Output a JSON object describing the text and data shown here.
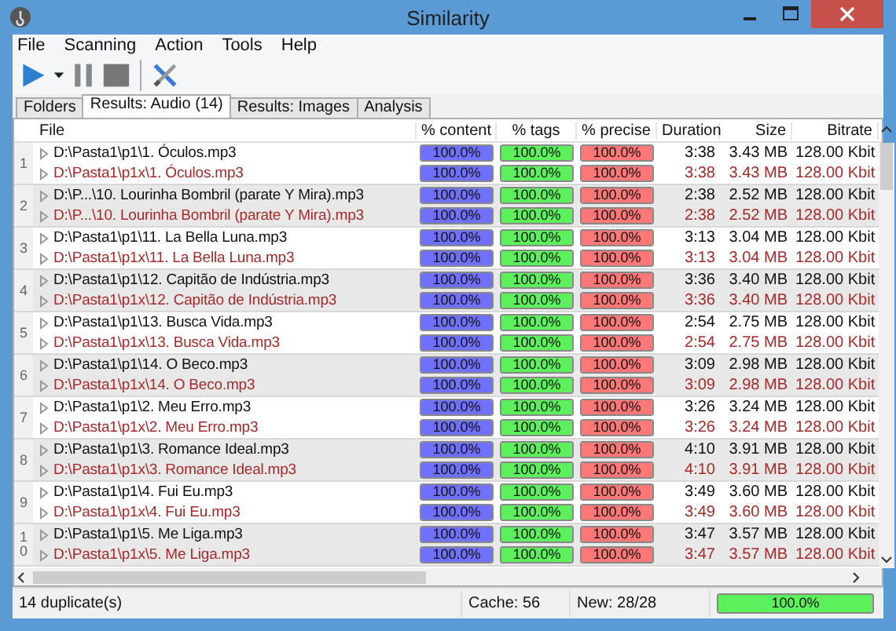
{
  "window": {
    "title": "Similarity"
  },
  "menu": [
    "File",
    "Scanning",
    "Action",
    "Tools",
    "Help"
  ],
  "tabs": [
    {
      "label": "Folders",
      "selected": false
    },
    {
      "label": "Results: Audio (14)",
      "selected": true
    },
    {
      "label": "Results: Images",
      "selected": false
    },
    {
      "label": "Analysis",
      "selected": false
    }
  ],
  "table": {
    "columns": [
      "File",
      "% content",
      "% tags",
      "% precise",
      "Duration",
      "Size",
      "Bitrate"
    ],
    "groups": [
      {
        "number": "1",
        "rows": [
          {
            "duplicate": false,
            "file": "D:\\Pasta1\\p1\\1. Óculos.mp3",
            "bars": [
              {
                "text": "100.0%",
                "level": 1
              },
              {
                "text": "100.0%",
                "level": 1
              },
              {
                "text": "100.0%",
                "level": 1
              }
            ],
            "duration": "3:38",
            "size": "3.43 MB",
            "bitrate": "128.00 Kbit"
          },
          {
            "duplicate": true,
            "file": "D:\\Pasta1\\p1x\\1. Óculos.mp3",
            "bars": [
              {
                "text": "100.0%",
                "level": 1
              },
              {
                "text": "100.0%",
                "level": 1
              },
              {
                "text": "100.0%",
                "level": 1
              }
            ],
            "duration": "3:38",
            "size": "3.43 MB",
            "bitrate": "128.00 Kbit"
          }
        ]
      },
      {
        "number": "2",
        "rows": [
          {
            "duplicate": false,
            "file": "D:\\P...\\10. Lourinha Bombril (parate Y Mira).mp3",
            "bars": [
              {
                "text": "100.0%",
                "level": 1
              },
              {
                "text": "100.0%",
                "level": 1
              },
              {
                "text": "100.0%",
                "level": 1
              }
            ],
            "duration": "2:38",
            "size": "2.52 MB",
            "bitrate": "128.00 Kbit"
          },
          {
            "duplicate": true,
            "file": "D:\\P...\\10. Lourinha Bombril (parate Y Mira).mp3",
            "bars": [
              {
                "text": "100.0%",
                "level": 1
              },
              {
                "text": "100.0%",
                "level": 1
              },
              {
                "text": "100.0%",
                "level": 1
              }
            ],
            "duration": "2:38",
            "size": "2.52 MB",
            "bitrate": "128.00 Kbit"
          }
        ]
      },
      {
        "number": "3",
        "rows": [
          {
            "duplicate": false,
            "file": "D:\\Pasta1\\p1\\11. La Bella Luna.mp3",
            "bars": [
              {
                "text": "100.0%",
                "level": 1
              },
              {
                "text": "100.0%",
                "level": 1
              },
              {
                "text": "100.0%",
                "level": 1
              }
            ],
            "duration": "3:13",
            "size": "3.04 MB",
            "bitrate": "128.00 Kbit"
          },
          {
            "duplicate": true,
            "file": "D:\\Pasta1\\p1x\\11. La Bella Luna.mp3",
            "bars": [
              {
                "text": "100.0%",
                "level": 1
              },
              {
                "text": "100.0%",
                "level": 1
              },
              {
                "text": "100.0%",
                "level": 1
              }
            ],
            "duration": "3:13",
            "size": "3.04 MB",
            "bitrate": "128.00 Kbit"
          }
        ]
      },
      {
        "number": "4",
        "rows": [
          {
            "duplicate": false,
            "file": "D:\\Pasta1\\p1\\12. Capitão de Indústria.mp3",
            "bars": [
              {
                "text": "100.0%",
                "level": 1
              },
              {
                "text": "100.0%",
                "level": 1
              },
              {
                "text": "100.0%",
                "level": 1
              }
            ],
            "duration": "3:36",
            "size": "3.40 MB",
            "bitrate": "128.00 Kbit"
          },
          {
            "duplicate": true,
            "file": "D:\\Pasta1\\p1x\\12. Capitão de Indústria.mp3",
            "bars": [
              {
                "text": "100.0%",
                "level": 1
              },
              {
                "text": "100.0%",
                "level": 1
              },
              {
                "text": "100.0%",
                "level": 1
              }
            ],
            "duration": "3:36",
            "size": "3.40 MB",
            "bitrate": "128.00 Kbit"
          }
        ]
      },
      {
        "number": "5",
        "rows": [
          {
            "duplicate": false,
            "file": "D:\\Pasta1\\p1\\13. Busca Vida.mp3",
            "bars": [
              {
                "text": "100.0%",
                "level": 1
              },
              {
                "text": "100.0%",
                "level": 1
              },
              {
                "text": "100.0%",
                "level": 1
              }
            ],
            "duration": "2:54",
            "size": "2.75 MB",
            "bitrate": "128.00 Kbit"
          },
          {
            "duplicate": true,
            "file": "D:\\Pasta1\\p1x\\13. Busca Vida.mp3",
            "bars": [
              {
                "text": "100.0%",
                "level": 1
              },
              {
                "text": "100.0%",
                "level": 1
              },
              {
                "text": "100.0%",
                "level": 1
              }
            ],
            "duration": "2:54",
            "size": "2.75 MB",
            "bitrate": "128.00 Kbit"
          }
        ]
      },
      {
        "number": "6",
        "rows": [
          {
            "duplicate": false,
            "file": "D:\\Pasta1\\p1\\14. O Beco.mp3",
            "bars": [
              {
                "text": "100.0%",
                "level": 1
              },
              {
                "text": "100.0%",
                "level": 1
              },
              {
                "text": "100.0%",
                "level": 1
              }
            ],
            "duration": "3:09",
            "size": "2.98 MB",
            "bitrate": "128.00 Kbit"
          },
          {
            "duplicate": true,
            "file": "D:\\Pasta1\\p1x\\14. O Beco.mp3",
            "bars": [
              {
                "text": "100.0%",
                "level": 1
              },
              {
                "text": "100.0%",
                "level": 1
              },
              {
                "text": "100.0%",
                "level": 1
              }
            ],
            "duration": "3:09",
            "size": "2.98 MB",
            "bitrate": "128.00 Kbit"
          }
        ]
      },
      {
        "number": "7",
        "rows": [
          {
            "duplicate": false,
            "file": "D:\\Pasta1\\p1\\2. Meu Erro.mp3",
            "bars": [
              {
                "text": "100.0%",
                "level": 1
              },
              {
                "text": "100.0%",
                "level": 1
              },
              {
                "text": "100.0%",
                "level": 1
              }
            ],
            "duration": "3:26",
            "size": "3.24 MB",
            "bitrate": "128.00 Kbit"
          },
          {
            "duplicate": true,
            "file": "D:\\Pasta1\\p1x\\2. Meu Erro.mp3",
            "bars": [
              {
                "text": "100.0%",
                "level": 1
              },
              {
                "text": "100.0%",
                "level": 1
              },
              {
                "text": "100.0%",
                "level": 1
              }
            ],
            "duration": "3:26",
            "size": "3.24 MB",
            "bitrate": "128.00 Kbit"
          }
        ]
      },
      {
        "number": "8",
        "rows": [
          {
            "duplicate": false,
            "file": "D:\\Pasta1\\p1\\3. Romance Ideal.mp3",
            "bars": [
              {
                "text": "100.0%",
                "level": 1
              },
              {
                "text": "100.0%",
                "level": 1
              },
              {
                "text": "100.0%",
                "level": 1
              }
            ],
            "duration": "4:10",
            "size": "3.91 MB",
            "bitrate": "128.00 Kbit"
          },
          {
            "duplicate": true,
            "file": "D:\\Pasta1\\p1x\\3. Romance Ideal.mp3",
            "bars": [
              {
                "text": "100.0%",
                "level": 1
              },
              {
                "text": "100.0%",
                "level": 1
              },
              {
                "text": "100.0%",
                "level": 1
              }
            ],
            "duration": "4:10",
            "size": "3.91 MB",
            "bitrate": "128.00 Kbit"
          }
        ]
      },
      {
        "number": "9",
        "rows": [
          {
            "duplicate": false,
            "file": "D:\\Pasta1\\p1\\4. Fui Eu.mp3",
            "bars": [
              {
                "text": "100.0%",
                "level": 1
              },
              {
                "text": "100.0%",
                "level": 1
              },
              {
                "text": "100.0%",
                "level": 1
              }
            ],
            "duration": "3:49",
            "size": "3.60 MB",
            "bitrate": "128.00 Kbit"
          },
          {
            "duplicate": true,
            "file": "D:\\Pasta1\\p1x\\4. Fui Eu.mp3",
            "bars": [
              {
                "text": "100.0%",
                "level": 1
              },
              {
                "text": "100.0%",
                "level": 1
              },
              {
                "text": "100.0%",
                "level": 1
              }
            ],
            "duration": "3:49",
            "size": "3.60 MB",
            "bitrate": "128.00 Kbit"
          }
        ]
      },
      {
        "number": "10",
        "rows": [
          {
            "duplicate": false,
            "file": "D:\\Pasta1\\p1\\5. Me Liga.mp3",
            "bars": [
              {
                "text": "100.0%",
                "level": 1
              },
              {
                "text": "100.0%",
                "level": 1
              },
              {
                "text": "100.0%",
                "level": 1
              }
            ],
            "duration": "3:47",
            "size": "3.57 MB",
            "bitrate": "128.00 Kbit"
          },
          {
            "duplicate": true,
            "file": "D:\\Pasta1\\p1x\\5. Me Liga.mp3",
            "bars": [
              {
                "text": "100.0%",
                "level": 1
              },
              {
                "text": "100.0%",
                "level": 1
              },
              {
                "text": "100.0%",
                "level": 1
              }
            ],
            "duration": "3:47",
            "size": "3.57 MB",
            "bitrate": "128.00 Kbit"
          }
        ]
      }
    ]
  },
  "status_bar": {
    "duplicates": "14 duplicate(s)",
    "cache": "Cache: 56",
    "new": "New: 28/28",
    "progress": {
      "text": "100.0%",
      "level": 1
    }
  }
}
